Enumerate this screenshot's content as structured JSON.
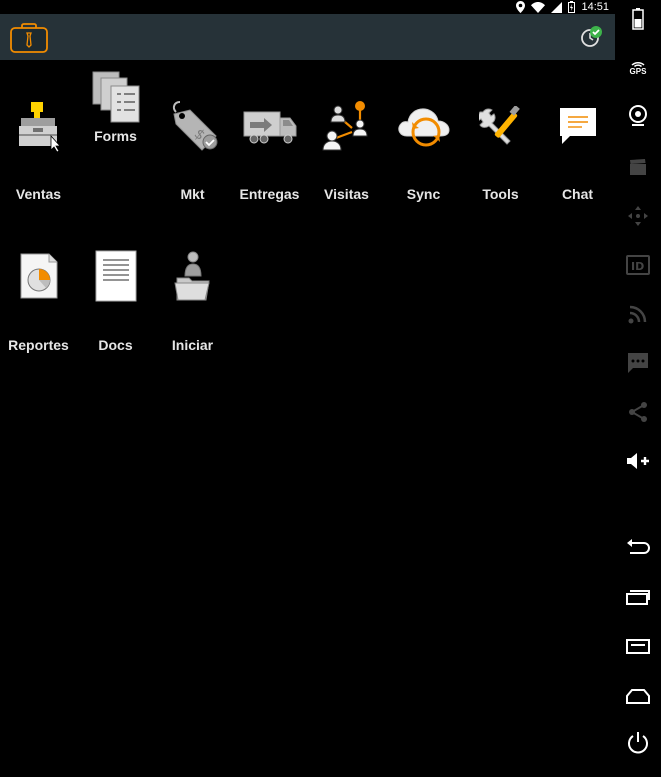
{
  "status_bar": {
    "time": "14:51"
  },
  "app": {
    "tiles": [
      {
        "label": "Ventas",
        "icon": "cash-register-icon"
      },
      {
        "label": "Forms",
        "icon": "forms-icon"
      },
      {
        "label": "Mkt",
        "icon": "price-tag-icon"
      },
      {
        "label": "Entregas",
        "icon": "truck-icon"
      },
      {
        "label": "Visitas",
        "icon": "visits-network-icon"
      },
      {
        "label": "Sync",
        "icon": "cloud-sync-icon"
      },
      {
        "label": "Tools",
        "icon": "tools-icon"
      },
      {
        "label": "Chat",
        "icon": "chat-icon"
      },
      {
        "label": "Reportes",
        "icon": "report-chart-icon"
      },
      {
        "label": "Docs",
        "icon": "document-icon"
      },
      {
        "label": "Iniciar",
        "icon": "user-folder-icon"
      }
    ]
  },
  "rail": {
    "gps_label": "GPS",
    "id_label": "ID"
  },
  "colors": {
    "header_bg": "#263238",
    "accent_orange": "#f28c00",
    "sync_ok_green": "#3db34a",
    "label_text": "#e6e6e6"
  }
}
